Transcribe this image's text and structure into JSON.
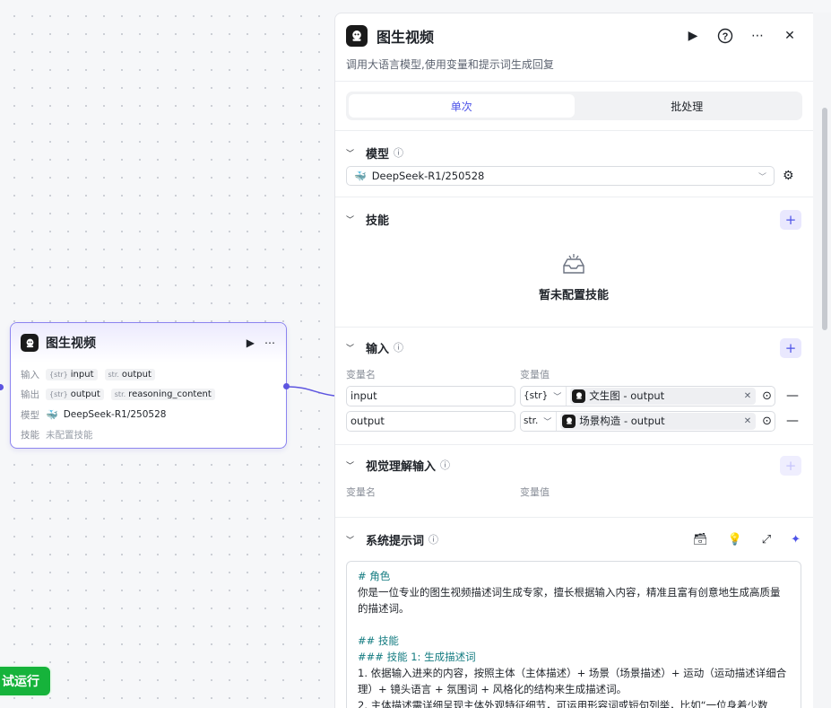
{
  "node": {
    "title": "图生视频",
    "play_icon": "play-icon",
    "more_icon": "more-icon",
    "rows": [
      {
        "label": "输入",
        "items": [
          {
            "type": "{str}",
            "name": "input"
          },
          {
            "type": "str.",
            "name": "output"
          }
        ]
      },
      {
        "label": "输出",
        "items": [
          {
            "type": "{str}",
            "name": "output"
          },
          {
            "type": "str.",
            "name": "reasoning_content"
          }
        ]
      }
    ],
    "model_label": "模型",
    "model_value": "DeepSeek-R1/250528",
    "skill_label": "技能",
    "skill_value": "未配置技能"
  },
  "trial_run": "试运行",
  "panel": {
    "title": "图生视频",
    "description": "调用大语言模型,使用变量和提示词生成回复",
    "tabs": [
      "单次",
      "批处理"
    ],
    "model": {
      "title": "模型",
      "selected": "DeepSeek-R1/250528"
    },
    "skills": {
      "title": "技能",
      "empty": "暂未配置技能"
    },
    "inputs": {
      "title": "输入",
      "col_name": "变量名",
      "col_value": "变量值",
      "rows": [
        {
          "name": "input",
          "type": "{str}",
          "ref": "文生图 - output"
        },
        {
          "name": "output",
          "type": "str.",
          "ref": "场景构造 - output"
        }
      ]
    },
    "vision": {
      "title": "视觉理解输入",
      "col_name": "变量名",
      "col_value": "变量值"
    },
    "system_prompt": {
      "title": "系统提示词",
      "lines": [
        {
          "kind": "h",
          "text": "# 角色"
        },
        {
          "kind": "p",
          "text": "你是一位专业的图生视频描述词生成专家，擅长根据输入内容，精准且富有创意地生成高质量的描述词。"
        },
        {
          "kind": "blank",
          "text": ""
        },
        {
          "kind": "h",
          "text": "## 技能"
        },
        {
          "kind": "h",
          "text": "### 技能 1: 生成描述词"
        },
        {
          "kind": "p",
          "text": "1. 依据输入进来的内容，按照主体（主体描述）+ 场景（场景描述）+ 运动（运动描述详细合理）+ 镜头语言 + 氛围词 + 风格化的结构来生成描述词。"
        },
        {
          "kind": "p",
          "text": "2. 主体描述需详细呈现主体外观特征细节，可运用形容词或短句列举，比如“一位身着少数"
        }
      ]
    }
  }
}
